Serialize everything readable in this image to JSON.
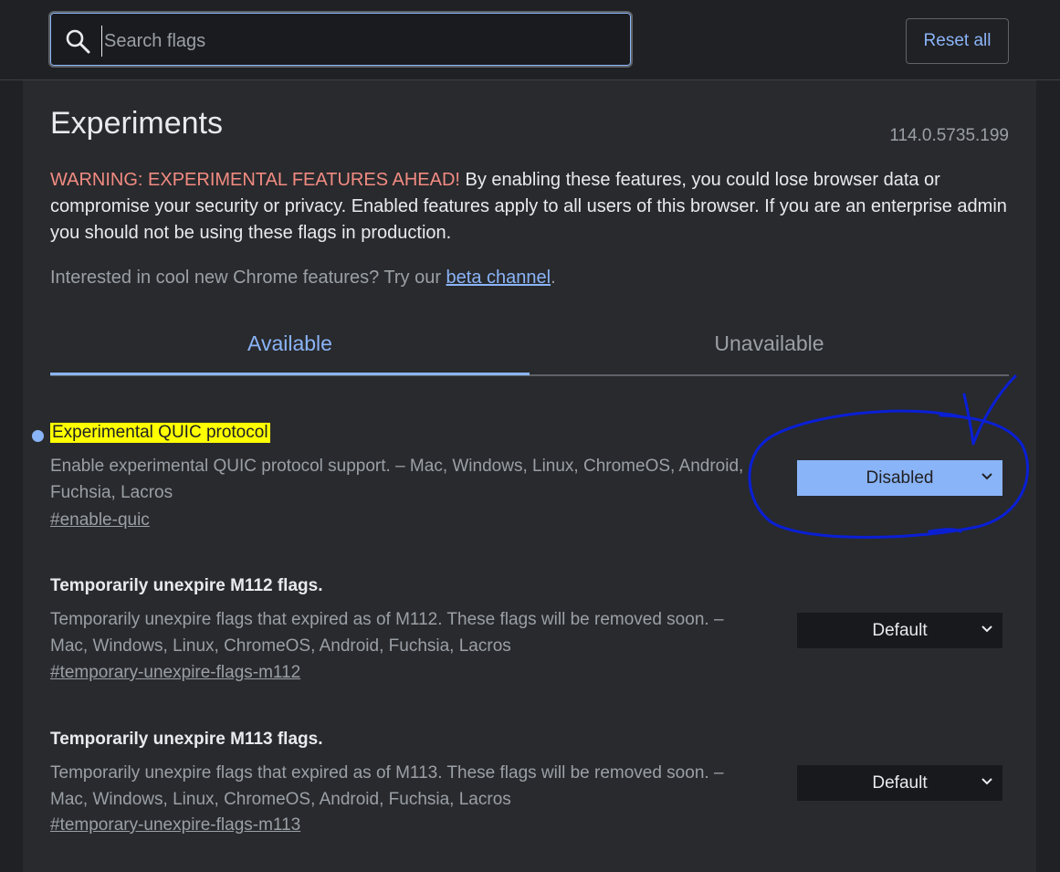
{
  "search": {
    "placeholder": "Search flags",
    "value": ""
  },
  "toolbar": {
    "reset_label": "Reset all"
  },
  "page": {
    "title": "Experiments",
    "version": "114.0.5735.199",
    "warning_label": "WARNING: EXPERIMENTAL FEATURES AHEAD!",
    "warning_text": " By enabling these features, you could lose browser data or compromise your security or privacy. Enabled features apply to all users of this browser. If you are an enterprise admin you should not be using these flags in production.",
    "interested_text": "Interested in cool new Chrome features? Try our ",
    "beta_link": "beta channel",
    "interested_end": "."
  },
  "tabs": [
    {
      "label": "Available",
      "active": true
    },
    {
      "label": "Unavailable",
      "active": false
    }
  ],
  "flags": [
    {
      "title": "Experimental QUIC protocol",
      "description": "Enable experimental QUIC protocol support. – Mac, Windows, Linux, ChromeOS, Android, Fuchsia, Lacros",
      "link": "#enable-quic",
      "value": "Disabled",
      "modified": true
    },
    {
      "title": "Temporarily unexpire M112 flags.",
      "description": "Temporarily unexpire flags that expired as of M112. These flags will be removed soon. – Mac, Windows, Linux, ChromeOS, Android, Fuchsia, Lacros",
      "link": "#temporary-unexpire-flags-m112",
      "value": "Default",
      "modified": false
    },
    {
      "title": "Temporarily unexpire M113 flags.",
      "description": "Temporarily unexpire flags that expired as of M113. These flags will be removed soon. – Mac, Windows, Linux, ChromeOS, Android, Fuchsia, Lacros",
      "link": "#temporary-unexpire-flags-m113",
      "value": "Default",
      "modified": false
    }
  ],
  "colors": {
    "accent": "#8ab4f8",
    "warning": "#f28b82",
    "highlight": "#ffff00",
    "annotation": "#0a1fd6"
  },
  "icons": {
    "search": "search-icon",
    "chevron": "chevron-down-icon"
  }
}
